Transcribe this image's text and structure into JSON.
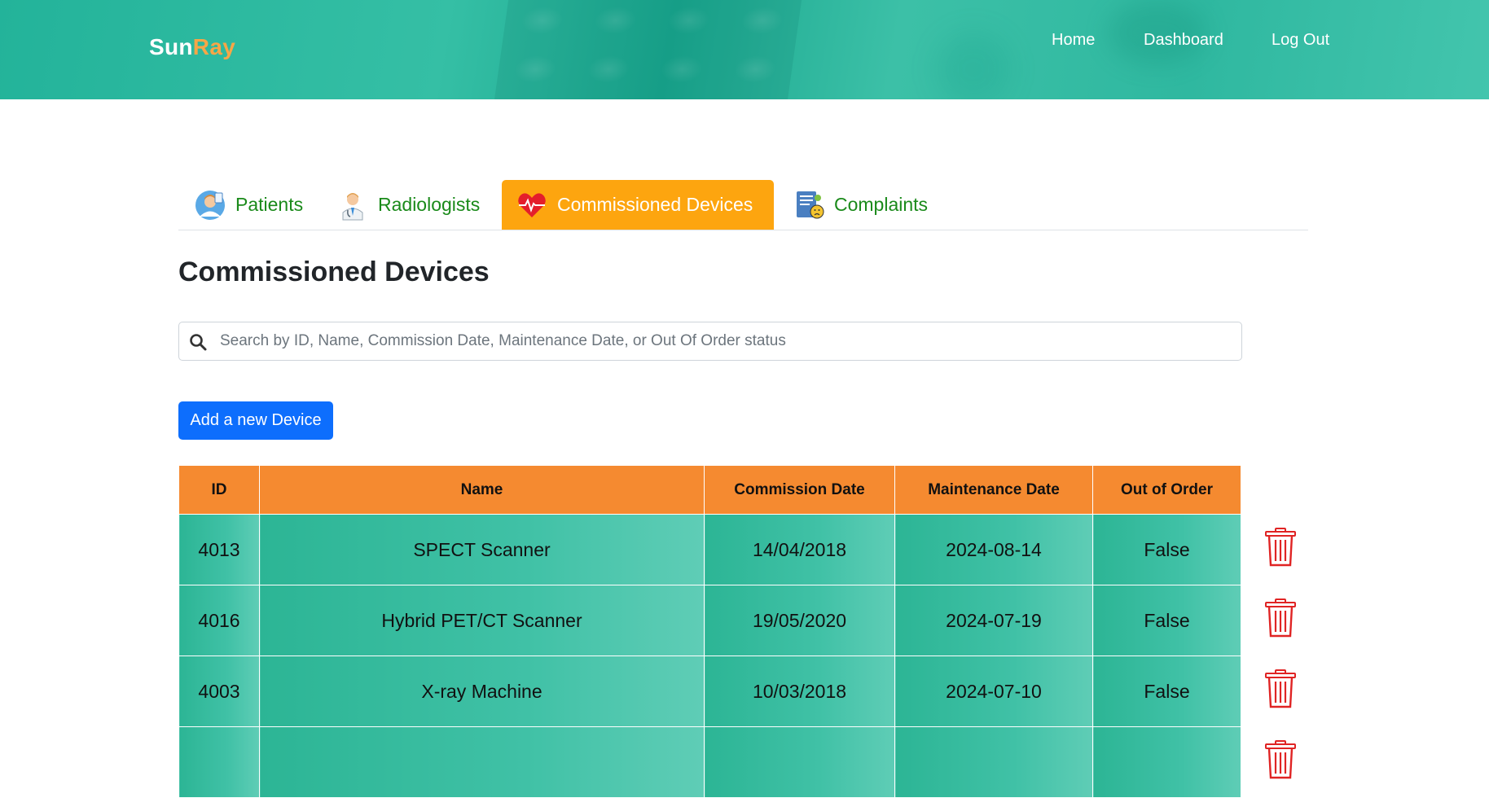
{
  "header": {
    "logo_part1": "Sun",
    "logo_part2": "Ray",
    "nav": {
      "home": "Home",
      "dashboard": "Dashboard",
      "logout": "Log Out"
    }
  },
  "tabs": [
    {
      "label": "Patients",
      "icon": "patient-icon",
      "active": false
    },
    {
      "label": "Radiologists",
      "icon": "doctor-icon",
      "active": false
    },
    {
      "label": "Commissioned Devices",
      "icon": "heart-pulse-icon",
      "active": true
    },
    {
      "label": "Complaints",
      "icon": "complaint-doc-icon",
      "active": false
    }
  ],
  "page_title": "Commissioned Devices",
  "search": {
    "placeholder": "Search by ID, Name, Commission Date, Maintenance Date, or Out Of Order status",
    "value": ""
  },
  "add_button": "Add a new Device",
  "table": {
    "columns": [
      "ID",
      "Name",
      "Commission Date",
      "Maintenance Date",
      "Out of Order"
    ],
    "rows": [
      {
        "id": "4013",
        "name": "SPECT Scanner",
        "commission": "14/04/2018",
        "maintenance": "2024-08-14",
        "out_of_order": "False"
      },
      {
        "id": "4016",
        "name": "Hybrid PET/CT Scanner",
        "commission": "19/05/2020",
        "maintenance": "2024-07-19",
        "out_of_order": "False"
      },
      {
        "id": "4003",
        "name": "X-ray Machine",
        "commission": "10/03/2018",
        "maintenance": "2024-07-10",
        "out_of_order": "False"
      },
      {
        "id": "",
        "name": "",
        "commission": "",
        "maintenance": "",
        "out_of_order": ""
      }
    ]
  },
  "colors": {
    "header_bg": "#2fb8a0",
    "logo_accent": "#f7a646",
    "active_tab": "#fda50f",
    "tab_text": "#1a8a1a",
    "table_header": "#f58a30",
    "row_bg": "#40c1a6",
    "primary_button": "#0d6efd",
    "delete_icon": "#e02424"
  }
}
